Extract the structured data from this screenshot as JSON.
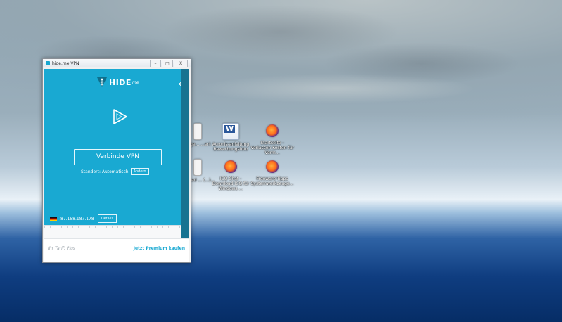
{
  "window": {
    "title": "hide.me VPN",
    "minimize": "–",
    "maximize": "□",
    "close": "X"
  },
  "app": {
    "logo_text": "HIDE",
    "logo_suffix": "me",
    "connect_label": "Verbinde VPN",
    "location_label": "Standort: Automatisch",
    "change_label": "Ändern",
    "ip_address": "87.158.187.178",
    "details_label": "Details",
    "tariff_text": "Ihr Tarif: Plus",
    "premium_link": "Jetzt Premium kaufen",
    "colors": {
      "panel": "#19a9d2",
      "scroll": "#177391",
      "accent": "#19a9d2"
    }
  },
  "desktop": {
    "icons": [
      {
        "label": "Rege... ...ert",
        "icon": "doc-icon"
      },
      {
        "label": "Acronis-anleitung Bewerbungsfoto",
        "icon": "word-icon"
      },
      {
        "label": "Startseite - Verlassen Kosten für Verm...",
        "icon": "firefox-icon"
      },
      {
        "label": "...ed.ed ... (...)...",
        "icon": "doc-icon"
      },
      {
        "label": "ICQ Chat - Download ICQ für Windows ...",
        "icon": "firefox-icon"
      },
      {
        "label": "Freeware-Tipps Systemwerkzeuge...",
        "icon": "firefox-icon"
      }
    ]
  }
}
